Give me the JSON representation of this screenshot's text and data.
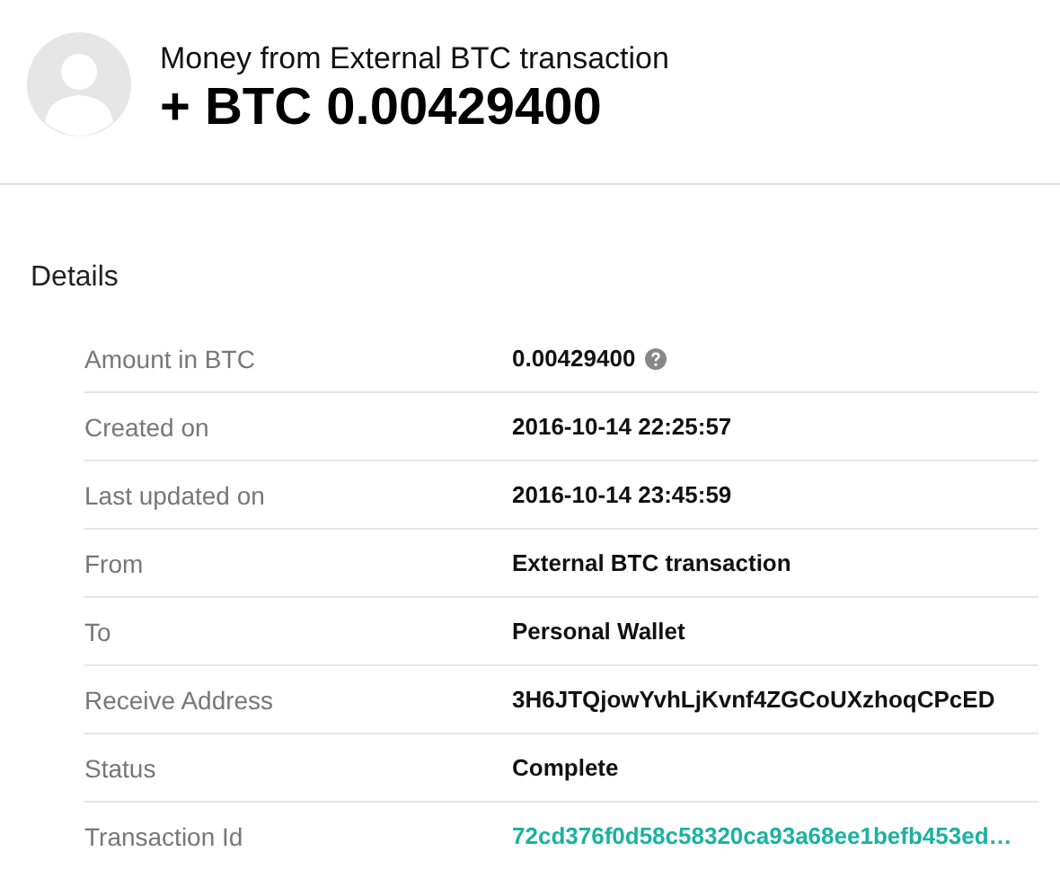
{
  "header": {
    "title": "Money from External BTC transaction",
    "amount": "+ BTC 0.00429400"
  },
  "details": {
    "heading": "Details",
    "rows": [
      {
        "label": "Amount in BTC",
        "value": "0.00429400",
        "kind": "help"
      },
      {
        "label": "Created on",
        "value": "2016-10-14 22:25:57",
        "kind": "text"
      },
      {
        "label": "Last updated on",
        "value": "2016-10-14 23:45:59",
        "kind": "text"
      },
      {
        "label": "From",
        "value": "External BTC transaction",
        "kind": "text"
      },
      {
        "label": "To",
        "value": "Personal Wallet",
        "kind": "text"
      },
      {
        "label": "Receive Address",
        "value": "3H6JTQjowYvhLjKvnf4ZGCoUXzhoqCPcED",
        "kind": "text"
      },
      {
        "label": "Status",
        "value": "Complete",
        "kind": "text"
      },
      {
        "label": "Transaction Id",
        "value": "72cd376f0d58c58320ca93a68ee1befb453ed…",
        "kind": "link"
      }
    ]
  }
}
